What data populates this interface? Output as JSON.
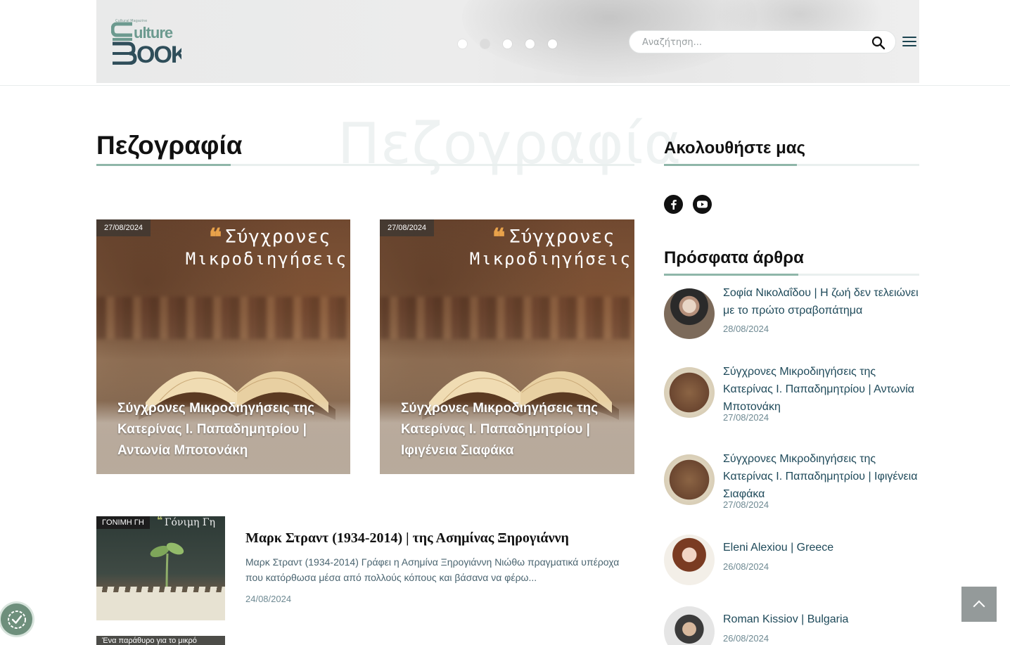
{
  "header": {
    "logo_alt": "Culture Book",
    "logo_tagline": "Cultural Magazine",
    "slider_dots": 5,
    "slider_active_index": 1,
    "search_placeholder": "Αναζήτηση..."
  },
  "main": {
    "section_title": "Πεζογραφία",
    "ghost_title": "Πεζογραφία",
    "featured": [
      {
        "date": "27/08/2024",
        "image_heading_line1": "Σύγχρονες",
        "image_heading_line2": "Μικροδιηγήσεις",
        "title": "Σύγχρονες Μικροδιηγήσεις της Κατερίνας Ι. Παπαδημητρίου | Αντωνία Μποτονάκη"
      },
      {
        "date": "27/08/2024",
        "image_heading_line1": "Σύγχρονες",
        "image_heading_line2": "Μικροδιηγήσεις",
        "title": "Σύγχρονες Μικροδιηγήσεις της Κατερίνας Ι. Παπαδημητρίου | Ιφιγένεια Σιαφάκα"
      }
    ],
    "list": [
      {
        "tag": "ΓΟΝΙΜΗ ΓΗ",
        "image_script": "Γόνιμη Γη",
        "title": "Μαρκ Στραντ (1934-2014) | της Ασημίνας Ξηρογιάννη",
        "excerpt": "Μαρκ Στραντ (1934-2014) Γράφει η Ασημίνα Ξηρογιάννη Νιώθω πραγματικά υπέροχα που κατόρθωσα μέσα από πολλούς κόπους και βάσανα να φέρω...",
        "date": "24/08/2024"
      },
      {
        "tag": "Ένα παράθυρο για το μικρό"
      }
    ]
  },
  "sidebar": {
    "follow_title": "Ακολουθήστε μας",
    "social": [
      {
        "name": "facebook-icon",
        "glyph": "f"
      },
      {
        "name": "youtube-icon",
        "glyph": "▶"
      }
    ],
    "recent_title": "Πρόσφατα άρθρα",
    "recent": [
      {
        "title": "Σοφία Νικολαΐδου | Η ζωή δεν τελειώνει με το πρώτο στραβοπάτημα",
        "date": "28/08/2024"
      },
      {
        "title": "Σύγχρονες Μικροδιηγήσεις της Κατερίνας Ι. Παπαδημητρίου | Αντωνία Μποτονάκη",
        "date": "27/08/2024"
      },
      {
        "title": "Σύγχρονες Μικροδιηγήσεις της Κατερίνας Ι. Παπαδημητρίου | Ιφιγένεια Σιαφάκα",
        "date": "27/08/2024"
      },
      {
        "title": "Eleni Alexiou | Greece",
        "date": "26/08/2024"
      },
      {
        "title": "Roman Kissiov | Bulgaria",
        "date": "26/08/2024"
      }
    ]
  },
  "colors": {
    "accent": "#8fb6a9",
    "link": "#1f4a5a",
    "meta": "#6f8a93",
    "logo_dark": "#2f4e5a",
    "logo_light": "#5b8f87"
  }
}
